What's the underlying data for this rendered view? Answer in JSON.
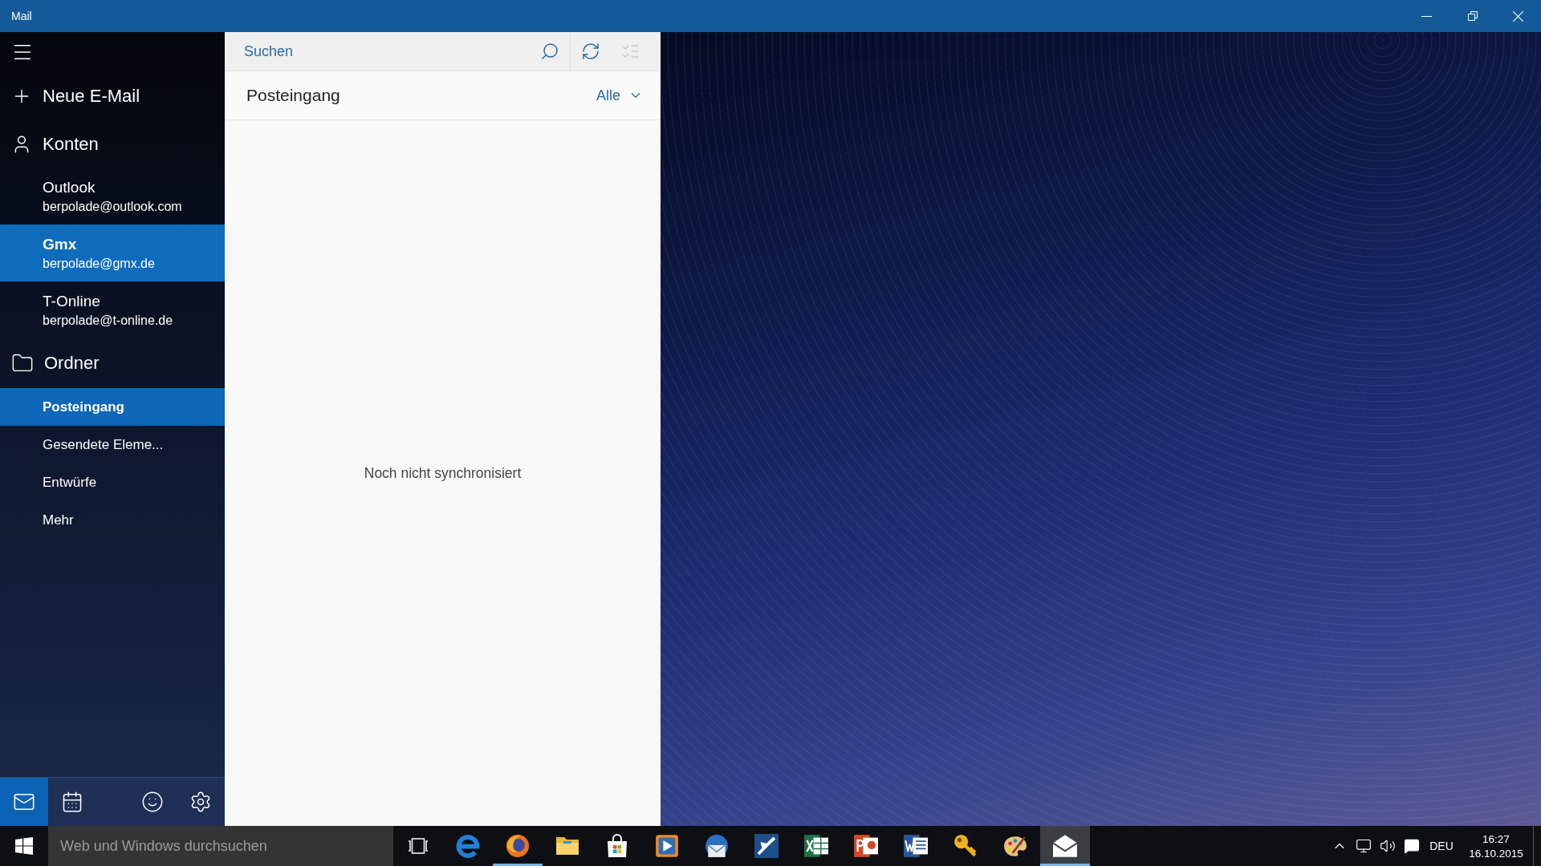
{
  "window": {
    "title": "Mail"
  },
  "sidebar": {
    "new_mail": "Neue E-Mail",
    "accounts": {
      "heading": "Konten",
      "items": [
        {
          "name": "Outlook",
          "email": "berpolade@outlook.com",
          "selected": false
        },
        {
          "name": "Gmx",
          "email": "berpolade@gmx.de",
          "selected": true
        },
        {
          "name": "T-Online",
          "email": "berpolade@t-online.de",
          "selected": false
        }
      ]
    },
    "folders": {
      "heading": "Ordner",
      "items": [
        {
          "label": "Posteingang",
          "selected": true
        },
        {
          "label": "Gesendete Eleme...",
          "selected": false
        },
        {
          "label": "Entwürfe",
          "selected": false
        },
        {
          "label": "Mehr",
          "selected": false
        }
      ]
    },
    "bottom_nav": [
      {
        "kind": "mail",
        "selected": true
      },
      {
        "kind": "calendar",
        "selected": false
      },
      {
        "kind": "feedback",
        "selected": false
      },
      {
        "kind": "settings",
        "selected": false
      }
    ]
  },
  "message_list": {
    "search": {
      "placeholder": "Suchen"
    },
    "actions": [
      {
        "kind": "sync",
        "disabled": false
      },
      {
        "kind": "select",
        "disabled": true
      }
    ],
    "folder_title": "Posteingang",
    "filter": {
      "value": "Alle"
    },
    "empty_message": "Noch nicht synchronisiert"
  },
  "taskbar": {
    "search": {
      "placeholder": "Web und Windows durchsuchen"
    },
    "apps": [
      {
        "kind": "edge",
        "running": false,
        "selected": false
      },
      {
        "kind": "firefox",
        "running": true,
        "selected": false
      },
      {
        "kind": "explorer",
        "running": false,
        "selected": false
      },
      {
        "kind": "store",
        "running": false,
        "selected": false
      },
      {
        "kind": "player",
        "running": false,
        "selected": false
      },
      {
        "kind": "thunderbird",
        "running": false,
        "selected": false
      },
      {
        "kind": "swoosh",
        "running": false,
        "selected": false
      },
      {
        "kind": "excel",
        "running": false,
        "selected": false
      },
      {
        "kind": "powerpoint",
        "running": false,
        "selected": false
      },
      {
        "kind": "word",
        "running": false,
        "selected": false
      },
      {
        "kind": "key",
        "running": false,
        "selected": false
      },
      {
        "kind": "paint",
        "running": false,
        "selected": false
      },
      {
        "kind": "mail",
        "running": true,
        "selected": true
      }
    ],
    "tray": {
      "language": "DEU",
      "time": "16:27",
      "date": "16.10.2015"
    }
  }
}
